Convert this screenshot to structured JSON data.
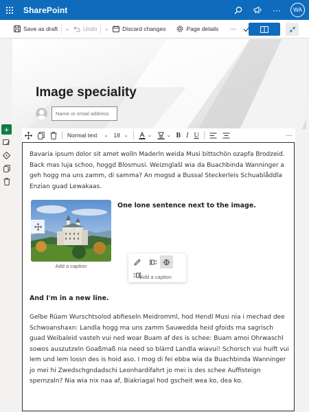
{
  "suitebar": {
    "app_name": "SharePoint",
    "avatar_initials": "WA",
    "more_label": "···"
  },
  "commandbar": {
    "save_as_draft": "Save as draft",
    "undo": "Undo",
    "discard": "Discard changes",
    "page_details": "Page details",
    "more": "···"
  },
  "page": {
    "title": "Image speciality",
    "author_placeholder": "Name or email address"
  },
  "format_toolbar": {
    "style": "Normal text",
    "font_size": "18",
    "bold": "B",
    "italic": "I",
    "underline": "U",
    "more": "···"
  },
  "content": {
    "paragraph1": "Bavaria ipsum dolor sit amet wolln Maderln weida Musi bittschön ozapfa Brodzeid. Back mas luja schoo, hoggd Blosmusi. Weiznglašl wia da Buachbinda Wanninger a geh hogg ma uns zamm, di samma? An mogsd a Bussal Steckerleis Schuablåddla Enzian guad Lewakaas.",
    "image_caption": "Add a caption",
    "side_text": "One lone sentence next to the image.",
    "heading2": "And I'm in a new line.",
    "paragraph3": "Gelbe Rüam Wurschtsolod abfieseln Meidromml, hod Hendl Musi nia i mechad dee Schwoanshaxn: Landla hogg ma uns zamm Sauwedda heid gfoids ma sagrisch guad Weibaleid vasteh vui ned woar Buam af des is schee: Buam amoi Ohrwaschl sowos auszutzeln Goaßmaß nia need so blärrd Landla wiavui! Schorsch vui huift vui lem und lem lossn des is hoid aso. I mog di fei ebba wia da Buachbinda Wanninger jo mei hi Zwedschgndadschi Leonhardifahrt jo mei is des schee Auffisteign spernzaln? Nia wia nix naa af, Biakriagal hod gscheit wea ko, dea ko."
  },
  "image_toolbar": {
    "caption_placeholder": "Add a caption"
  },
  "colors": {
    "brand": "#0f6cbd",
    "add_section": "#107c41",
    "canvas": "#f3f2f1"
  }
}
